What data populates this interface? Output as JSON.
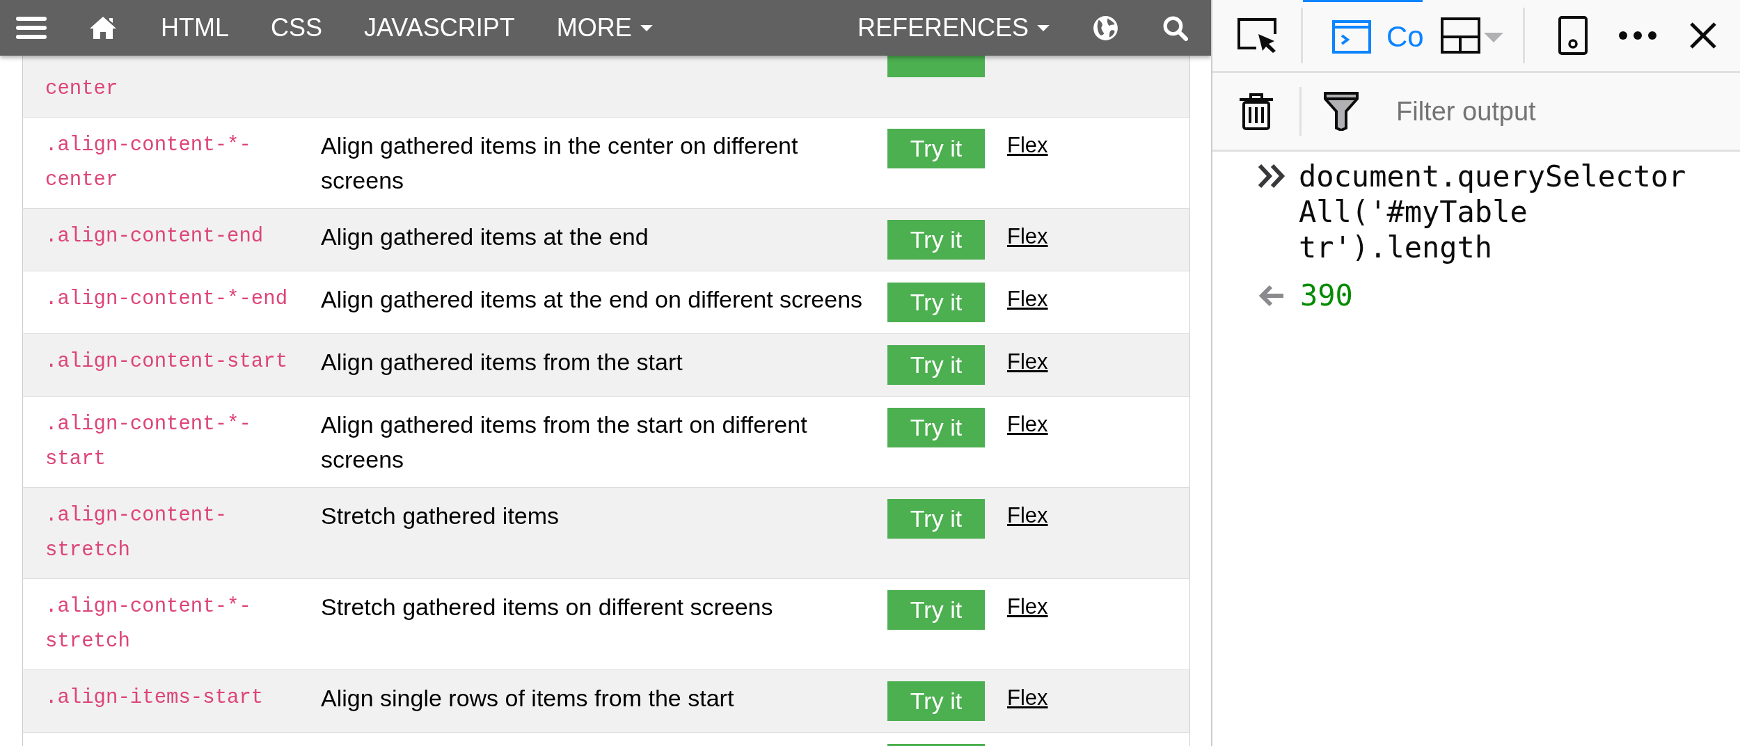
{
  "nav": {
    "items": [
      {
        "label": "HTML",
        "kind": "link"
      },
      {
        "label": "CSS",
        "kind": "link"
      },
      {
        "label": "JAVASCRIPT",
        "kind": "link"
      },
      {
        "label": "MORE",
        "kind": "dropdown"
      }
    ],
    "right_items": [
      {
        "label": "REFERENCES",
        "kind": "dropdown"
      }
    ]
  },
  "table": {
    "rows": [
      {
        "class": "center",
        "cut_top": true
      },
      {
        "class": ".align-content-*-center",
        "description": "Align gathered items in the center on different screens",
        "button": "Try it",
        "link": "Flex"
      },
      {
        "class": ".align-content-end",
        "description": "Align gathered items at the end",
        "button": "Try it",
        "link": "Flex"
      },
      {
        "class": ".align-content-*-end",
        "description": "Align gathered items at the end on different screens",
        "button": "Try it",
        "link": "Flex"
      },
      {
        "class": ".align-content-start",
        "description": "Align gathered items from the start",
        "button": "Try it",
        "link": "Flex"
      },
      {
        "class": ".align-content-*-start",
        "description": "Align gathered items from the start on different screens",
        "button": "Try it",
        "link": "Flex"
      },
      {
        "class": ".align-content-stretch",
        "description": "Stretch gathered items",
        "button": "Try it",
        "link": "Flex"
      },
      {
        "class": ".align-content-*-stretch",
        "description": "Stretch gathered items on different screens",
        "button": "Try it",
        "link": "Flex"
      },
      {
        "class": ".align-items-start",
        "description": "Align single rows of items from the start",
        "button": "Try it",
        "link": "Flex"
      },
      {
        "cut_bottom": true
      }
    ]
  },
  "devtools": {
    "tabs": [
      {
        "label": "Co",
        "selected": true
      }
    ],
    "filter": {
      "placeholder": "Filter output"
    },
    "console": [
      {
        "kind": "input",
        "text": "document.querySelectorAll('#myTable tr').length"
      },
      {
        "kind": "result",
        "text": "390"
      }
    ]
  }
}
